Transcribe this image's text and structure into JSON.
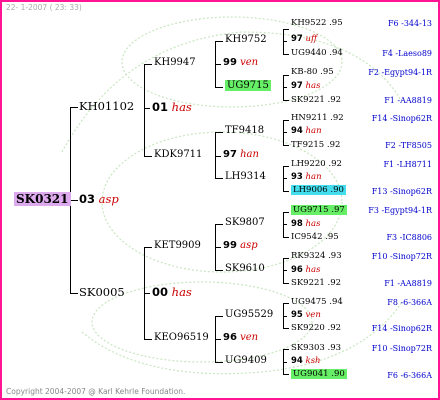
{
  "header": "22-  1-2007  ( 23: 33)",
  "footer": "Copyright 2004-2007 @ Karl Kehrle Foundation.",
  "colors": {
    "border": "#ff1493",
    "breeder": "#cc0000",
    "label": "#0000cc",
    "green_highlight": "#66ee66",
    "cyan_highlight": "#44ddee",
    "root_highlight": "#ddaaee"
  },
  "root": {
    "name": "SK0321"
  },
  "gen1": [
    {
      "name": "KH01102"
    },
    {
      "num": "03",
      "breeder": "asp"
    },
    {
      "name": "SK0005"
    }
  ],
  "gen2": [
    {
      "name": "KH9947"
    },
    {
      "num": "01",
      "breeder": "has"
    },
    {
      "name": "KDK9711"
    },
    {
      "name": "KET9909"
    },
    {
      "num": "00",
      "breeder": "has"
    },
    {
      "name": "KEO96519"
    }
  ],
  "gen3": [
    {
      "name": "KH9752"
    },
    {
      "num": "99",
      "breeder": "ven"
    },
    {
      "name": "UG9715"
    },
    {
      "name": "TF9418"
    },
    {
      "num": "97",
      "breeder": "han"
    },
    {
      "name": "LH9314"
    },
    {
      "name": "SK9807"
    },
    {
      "num": "99",
      "breeder": "asp"
    },
    {
      "name": "SK9610"
    },
    {
      "name": "UG95529"
    },
    {
      "num": "96",
      "breeder": "ven"
    },
    {
      "name": "UG9409"
    }
  ],
  "gen4": [
    {
      "top": "KH9522 .95",
      "num": "97",
      "breeder": "uff",
      "bottom": "UG9440 .94",
      "label_top": "F6 -344-13",
      "label_bottom": "F4 -Laeso89"
    },
    {
      "top": "KB-80 .95",
      "num": "97",
      "breeder": "has",
      "bottom": "SK9221 .92",
      "label_top": "F2 -Egypt94-1R",
      "label_bottom": "F1 -AA8819"
    },
    {
      "top": "HN9211 .92",
      "num": "94",
      "breeder": "han",
      "bottom": "TF9215 .92",
      "label_top": "F14 -Sinop62R",
      "label_bottom": "F2 -TF8505"
    },
    {
      "top": "LH9220 .92",
      "num": "93",
      "breeder": "han",
      "bottom": "LH9006 .90",
      "label_top": "F1 -LH8711",
      "label_bottom": "F13 -Sinop62R"
    },
    {
      "top": "UG9715 .97",
      "num": "98",
      "breeder": "has",
      "bottom": "IC9542 .95",
      "label_top": "F3 -Egypt94-1R",
      "label_bottom": "F3 -IC8806"
    },
    {
      "top": "RK9324 .93",
      "num": "96",
      "breeder": "has",
      "bottom": "SK9221 .92",
      "label_top": "F10 -Sinop72R",
      "label_bottom": "F1 -AA8819"
    },
    {
      "top": "UG9475 .94",
      "num": "95",
      "breeder": "ven",
      "bottom": "SK9220 .92",
      "label_top": "F8 -6-366A",
      "label_bottom": "F14 -Sinop62R"
    },
    {
      "top": "SK9303 .93",
      "num": "94",
      "breeder": "ksh",
      "bottom": "UG9041 .90",
      "label_top": "F10 -Sinop72R",
      "label_bottom": "F6 -6-366A"
    }
  ]
}
